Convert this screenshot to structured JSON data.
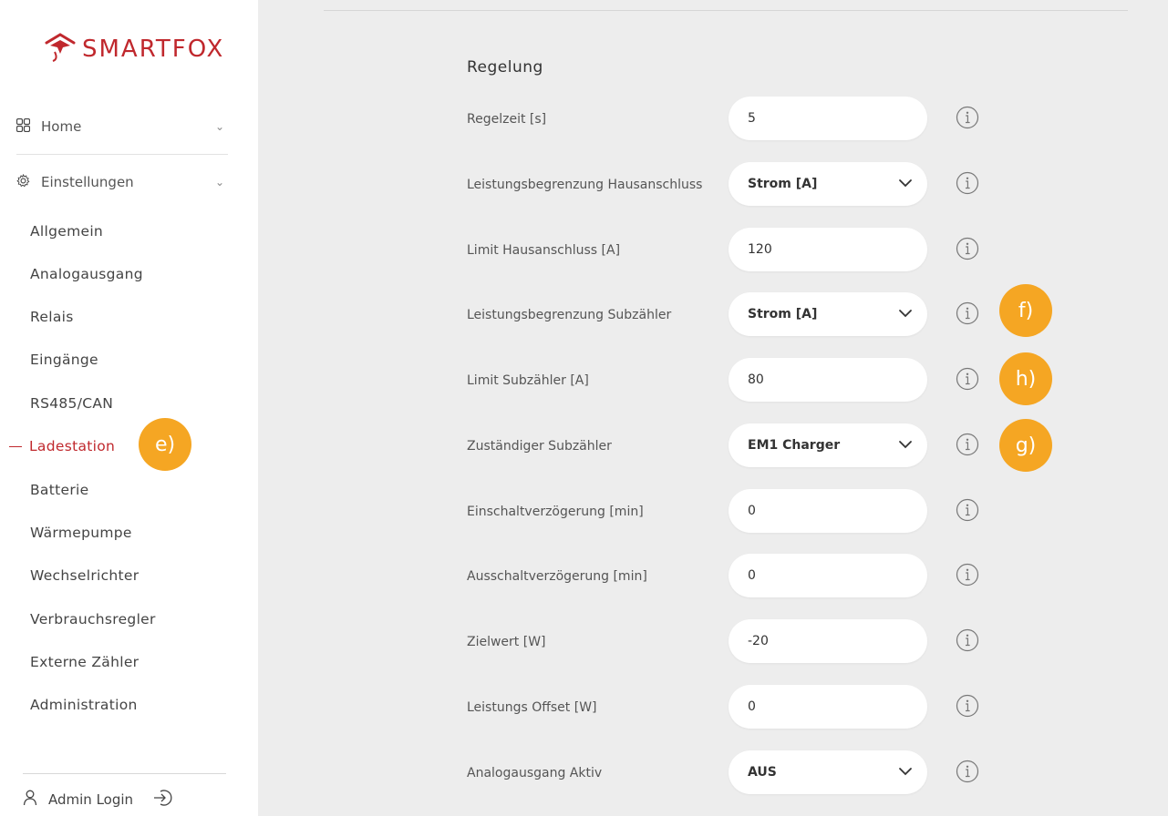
{
  "sidebar": {
    "logo_text": "SMARTFOX",
    "home": {
      "label": "Home",
      "icon": "grid-icon"
    },
    "settings": {
      "label": "Einstellungen",
      "icon": "gear-icon"
    },
    "items": [
      {
        "label": "Allgemein"
      },
      {
        "label": "Analogausgang"
      },
      {
        "label": "Relais"
      },
      {
        "label": "Eingänge"
      },
      {
        "label": "RS485/CAN"
      },
      {
        "label": "Ladestation",
        "active": true
      },
      {
        "label": "Batterie"
      },
      {
        "label": "Wärmepumpe"
      },
      {
        "label": "Wechselrichter"
      },
      {
        "label": "Verbrauchsregler"
      },
      {
        "label": "Externe Zähler"
      },
      {
        "label": "Administration"
      }
    ],
    "admin_login": "Admin Login"
  },
  "main": {
    "section_title": "Regelung",
    "rows": [
      {
        "label": "Regelzeit [s]",
        "type": "input",
        "value": "5"
      },
      {
        "label": "Leistungsbegrenzung Hausanschluss",
        "type": "select",
        "value": "Strom [A]"
      },
      {
        "label": "Limit Hausanschluss [A]",
        "type": "input",
        "value": "120"
      },
      {
        "label": "Leistungsbegrenzung Subzähler",
        "type": "select",
        "value": "Strom [A]"
      },
      {
        "label": "Limit Subzähler [A]",
        "type": "input",
        "value": "80"
      },
      {
        "label": "Zuständiger Subzähler",
        "type": "select",
        "value": "EM1 Charger"
      },
      {
        "label": "Einschaltverzögerung [min]",
        "type": "input",
        "value": "0"
      },
      {
        "label": "Ausschaltverzögerung [min]",
        "type": "input",
        "value": "0"
      },
      {
        "label": "Zielwert [W]",
        "type": "input",
        "value": "-20"
      },
      {
        "label": "Leistungs Offset [W]",
        "type": "input",
        "value": "0"
      },
      {
        "label": "Analogausgang Aktiv",
        "type": "select",
        "value": "AUS"
      }
    ]
  },
  "badges": {
    "e": "e)",
    "f": "f)",
    "h": "h)",
    "g": "g)"
  },
  "colors": {
    "brand": "#c0282d",
    "badge": "#f5a623",
    "background": "#ededed"
  }
}
